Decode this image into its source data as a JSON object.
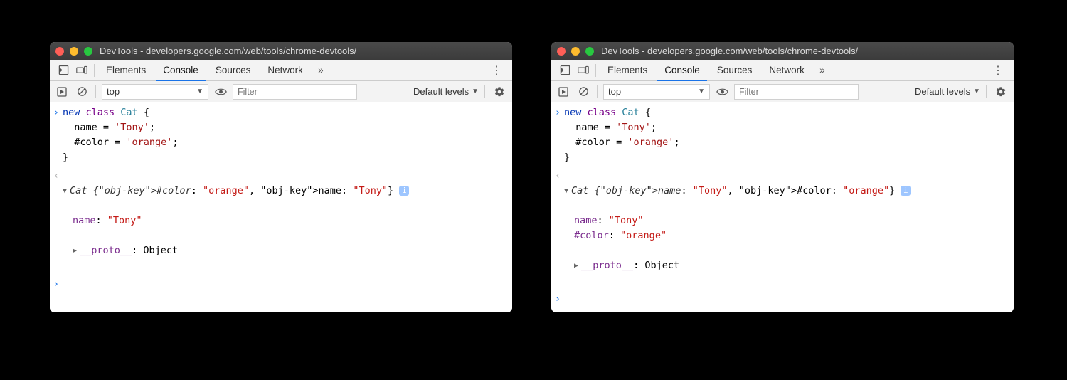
{
  "window_title": "DevTools - developers.google.com/web/tools/chrome-devtools/",
  "tabs": [
    "Elements",
    "Console",
    "Sources",
    "Network"
  ],
  "active_tab": 1,
  "overflow_glyph": "»",
  "toolbar": {
    "context": "top",
    "filter_placeholder": "Filter",
    "levels_label": "Default levels"
  },
  "input_code": "new class Cat {\n  name = 'Tony';\n  #color = 'orange';\n}",
  "panes": [
    {
      "summary_prefix": "Cat ",
      "summary_body": "{#color: \"orange\", name: \"Tony\"}",
      "properties": [
        {
          "key": "name",
          "value": "\"Tony\"",
          "type": "string"
        }
      ],
      "proto": "Object"
    },
    {
      "summary_prefix": "Cat ",
      "summary_body": "{name: \"Tony\", #color: \"orange\"}",
      "properties": [
        {
          "key": "name",
          "value": "\"Tony\"",
          "type": "string"
        },
        {
          "key": "#color",
          "value": "\"orange\"",
          "type": "string"
        }
      ],
      "proto": "Object"
    }
  ]
}
